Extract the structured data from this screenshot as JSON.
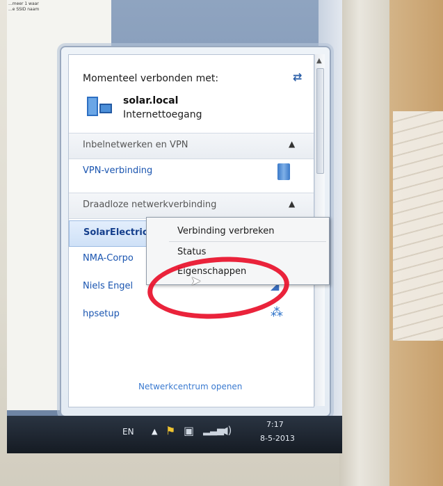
{
  "desktop": {
    "doc_lines": "...meer 1 waar\n...e SSID naam"
  },
  "flyout": {
    "connected_title": "Momenteel verbonden met:",
    "connected_network": {
      "name": "solar.local",
      "access": "Internettoegang"
    },
    "sections": [
      {
        "label": "Inbelnetwerken en VPN",
        "items": [
          {
            "label": "VPN-verbinding",
            "icon": "vpn-server-icon"
          }
        ]
      },
      {
        "label": "Draadloze netwerkverbinding",
        "items": [
          {
            "label": "SolarElectric",
            "selected": true
          },
          {
            "label": "NMA-Corpo"
          },
          {
            "label": "Niels Engel",
            "icon": "wifi-signal-icon"
          },
          {
            "label": "hpsetup",
            "icon": "hp-network-icon"
          }
        ]
      }
    ],
    "network_center_link": "Netwerkcentrum openen"
  },
  "context_menu": {
    "items": [
      "Verbinding verbreken",
      "Status",
      "Eigenschappen"
    ]
  },
  "taskbar": {
    "language": "EN",
    "clock_time": "7:17",
    "clock_date": "8-5-2013"
  },
  "colors": {
    "link_blue": "#1a55b0",
    "highlight_red": "#e8102a",
    "taskbar": "#1c232d"
  }
}
